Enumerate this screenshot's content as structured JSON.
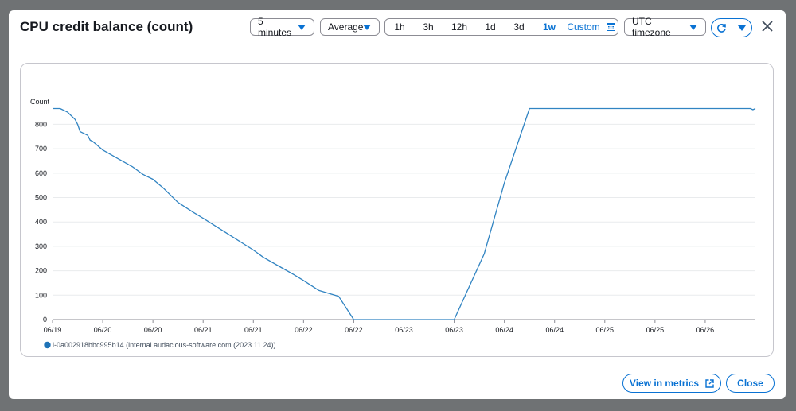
{
  "dialog": {
    "title": "CPU credit balance (count)",
    "period_select": "5 minutes",
    "stat_select": "Average",
    "time_ranges": [
      "1h",
      "3h",
      "12h",
      "1d",
      "3d",
      "1w"
    ],
    "active_range": "1w",
    "custom_label": "Custom",
    "timezone_select": "UTC timezone",
    "view_in_metrics_label": "View in metrics",
    "close_label": "Close"
  },
  "colors": {
    "accent": "#0972d3",
    "series_line": "#3184c2",
    "legend_swatch": "#1f73b7"
  },
  "icons": [
    "caret-down-icon",
    "calendar-icon",
    "refresh-icon",
    "close-icon",
    "external-link-icon"
  ],
  "chart_data": {
    "type": "line",
    "title": "",
    "ylabel": "Count",
    "xlabel": "",
    "ylim": [
      0,
      860
    ],
    "yticks": [
      0,
      100,
      200,
      300,
      400,
      500,
      600,
      700,
      800
    ],
    "xlim": [
      0,
      14
    ],
    "xtick_labels": [
      "06/19",
      "06/20",
      "06/20",
      "06/21",
      "06/21",
      "06/22",
      "06/22",
      "06/23",
      "06/23",
      "06/24",
      "06/24",
      "06/25",
      "06/25",
      "06/26"
    ],
    "grid": true,
    "legend_position": "bottom-left",
    "series": [
      {
        "name": "i-0a002918bbc995b14 (internal.audacious-software.com (2023.11.24))",
        "x": [
          0,
          0.15,
          0.3,
          0.45,
          0.5,
          0.55,
          0.7,
          0.75,
          0.8,
          1.0,
          1.3,
          1.6,
          1.8,
          2.0,
          2.2,
          2.5,
          2.8,
          3.0,
          3.5,
          4.0,
          4.2,
          4.5,
          4.8,
          5.0,
          5.3,
          5.7,
          6.0,
          6.2,
          6.35,
          6.4,
          6.5,
          7.0,
          8.0,
          8.6,
          9.0,
          9.5,
          10.0,
          11.0,
          12.0,
          13.0,
          13.9,
          13.95,
          14.0
        ],
        "y": [
          865,
          865,
          850,
          820,
          800,
          770,
          755,
          735,
          730,
          695,
          660,
          625,
          595,
          575,
          540,
          480,
          440,
          415,
          350,
          285,
          255,
          220,
          185,
          160,
          120,
          95,
          0,
          0,
          0,
          0,
          0,
          0,
          0,
          270,
          560,
          865,
          865,
          865,
          865,
          865,
          865,
          860,
          865
        ]
      }
    ]
  }
}
